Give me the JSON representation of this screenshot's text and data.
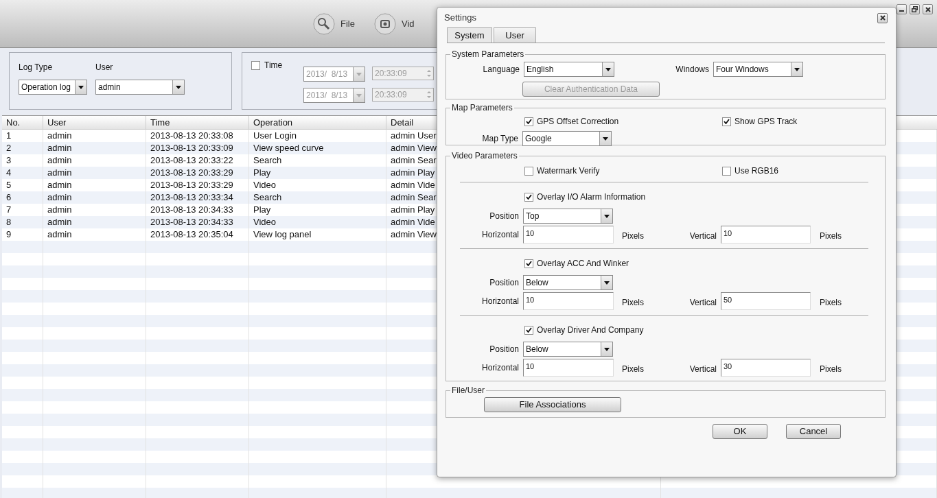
{
  "toolbar": {
    "buttons": [
      {
        "label": "File",
        "kind": "search"
      },
      {
        "label": "Vid",
        "kind": "video"
      }
    ]
  },
  "filter": {
    "log_type": {
      "label": "Log Type",
      "value": "Operation log"
    },
    "user": {
      "label": "User",
      "value": "admin"
    },
    "time": {
      "label": "Time",
      "checked": false,
      "disabled": true,
      "start_date": "2013/  8/13",
      "start_time": "20:33:09",
      "end_date": "2013/  8/13",
      "end_time": "20:33:09"
    }
  },
  "table": {
    "columns": [
      "No.",
      "User",
      "Time",
      "Operation",
      "Detail"
    ],
    "rows": [
      [
        "1",
        "admin",
        "2013-08-13 20:33:08",
        "User Login",
        "admin User"
      ],
      [
        "2",
        "admin",
        "2013-08-13 20:33:09",
        "View speed curve",
        "admin View"
      ],
      [
        "3",
        "admin",
        "2013-08-13 20:33:22",
        "Search",
        "admin Sear"
      ],
      [
        "4",
        "admin",
        "2013-08-13 20:33:29",
        "Play",
        "admin Play"
      ],
      [
        "5",
        "admin",
        "2013-08-13 20:33:29",
        "Video",
        "admin Vide"
      ],
      [
        "6",
        "admin",
        "2013-08-13 20:33:34",
        "Search",
        "admin Sear"
      ],
      [
        "7",
        "admin",
        "2013-08-13 20:34:33",
        "Play",
        "admin Play"
      ],
      [
        "8",
        "admin",
        "2013-08-13 20:34:33",
        "Video",
        "admin Vide"
      ],
      [
        "9",
        "admin",
        "2013-08-13 20:35:04",
        "View log panel",
        "admin View"
      ]
    ]
  },
  "dialog": {
    "title": "Settings",
    "tabs": [
      {
        "label": "System",
        "selected": true
      },
      {
        "label": "User",
        "selected": false
      }
    ],
    "system_parameters": {
      "title": "System Parameters",
      "language": {
        "label": "Language",
        "value": "English"
      },
      "windows": {
        "label": "Windows",
        "value": "Four Windows"
      },
      "clear_button": {
        "label": "Clear Authentication Data",
        "disabled": true
      }
    },
    "map_parameters": {
      "title": "Map Parameters",
      "gps_offset_correction": {
        "label": "GPS Offset Correction",
        "checked": true
      },
      "show_gps_track": {
        "label": "Show GPS Track",
        "checked": true
      },
      "map_type": {
        "label": "Map Type",
        "value": "Google"
      }
    },
    "video_parameters": {
      "title": "Video Parameters",
      "watermark_verify": {
        "label": "Watermark Verify",
        "checked": false
      },
      "use_rgb16": {
        "label": "Use RGB16",
        "checked": false
      },
      "overlays": [
        {
          "label": "Overlay I/O Alarm Information",
          "checked": true,
          "position_label": "Position",
          "position": "Top",
          "horizontal_label": "Horizontal",
          "horizontal": "10",
          "horizontal_unit": "Pixels",
          "vertical_label": "Vertical",
          "vertical": "10",
          "vertical_unit": "Pixels"
        },
        {
          "label": "Overlay ACC And Winker",
          "checked": true,
          "position_label": "Position",
          "position": "Below",
          "horizontal_label": "Horizontal",
          "horizontal": "10",
          "horizontal_unit": "Pixels",
          "vertical_label": "Vertical",
          "vertical": "50",
          "vertical_unit": "Pixels"
        },
        {
          "label": "Overlay Driver And Company",
          "checked": true,
          "position_label": "Position",
          "position": "Below",
          "horizontal_label": "Horizontal",
          "horizontal": "10",
          "horizontal_unit": "Pixels",
          "vertical_label": "Vertical",
          "vertical": "30",
          "vertical_unit": "Pixels"
        }
      ]
    },
    "file_user": {
      "title": "File/User",
      "button": "File Associations"
    },
    "buttons": [
      "OK",
      "Cancel"
    ]
  }
}
